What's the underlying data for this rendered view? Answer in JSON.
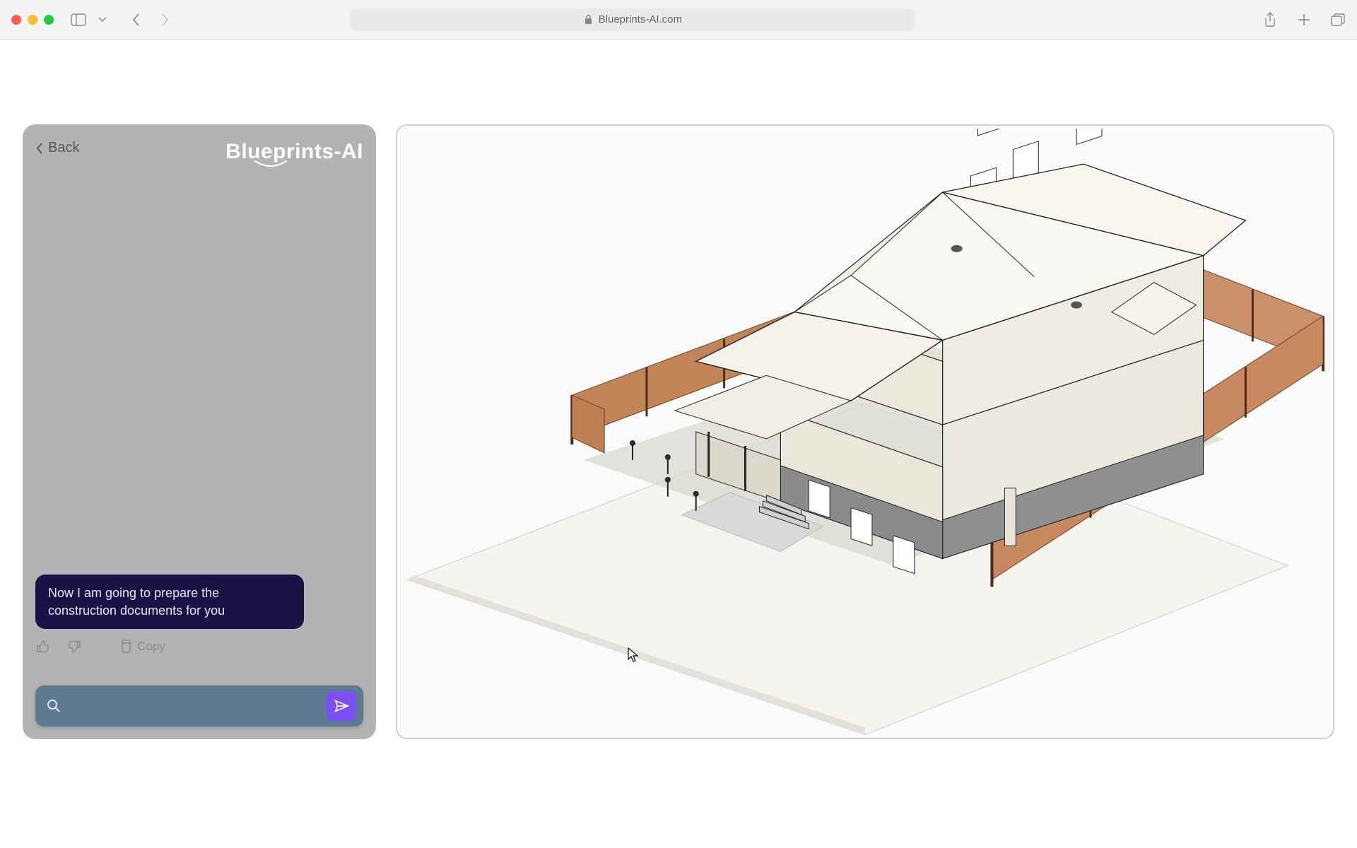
{
  "browser": {
    "url": "Blueprints-AI.com"
  },
  "sidebar": {
    "back_label": "Back",
    "brand": "Blueprints-AI",
    "message": "Now I am going to prepare the construction documents for you",
    "copy_label": "Copy",
    "input_placeholder": ""
  },
  "viewport": {
    "scene_description": "Isometric 3D rendering of a two-story residential house with hip roof, front porch, surrounded by wooden fence, on a concrete/light ground plane"
  },
  "colors": {
    "chat_bg": "#b3b3b3",
    "bubble_bg": "#1a1145",
    "input_bg": "#5d7a92",
    "send_btn": "#7b50f0",
    "fence": "#c88860"
  }
}
